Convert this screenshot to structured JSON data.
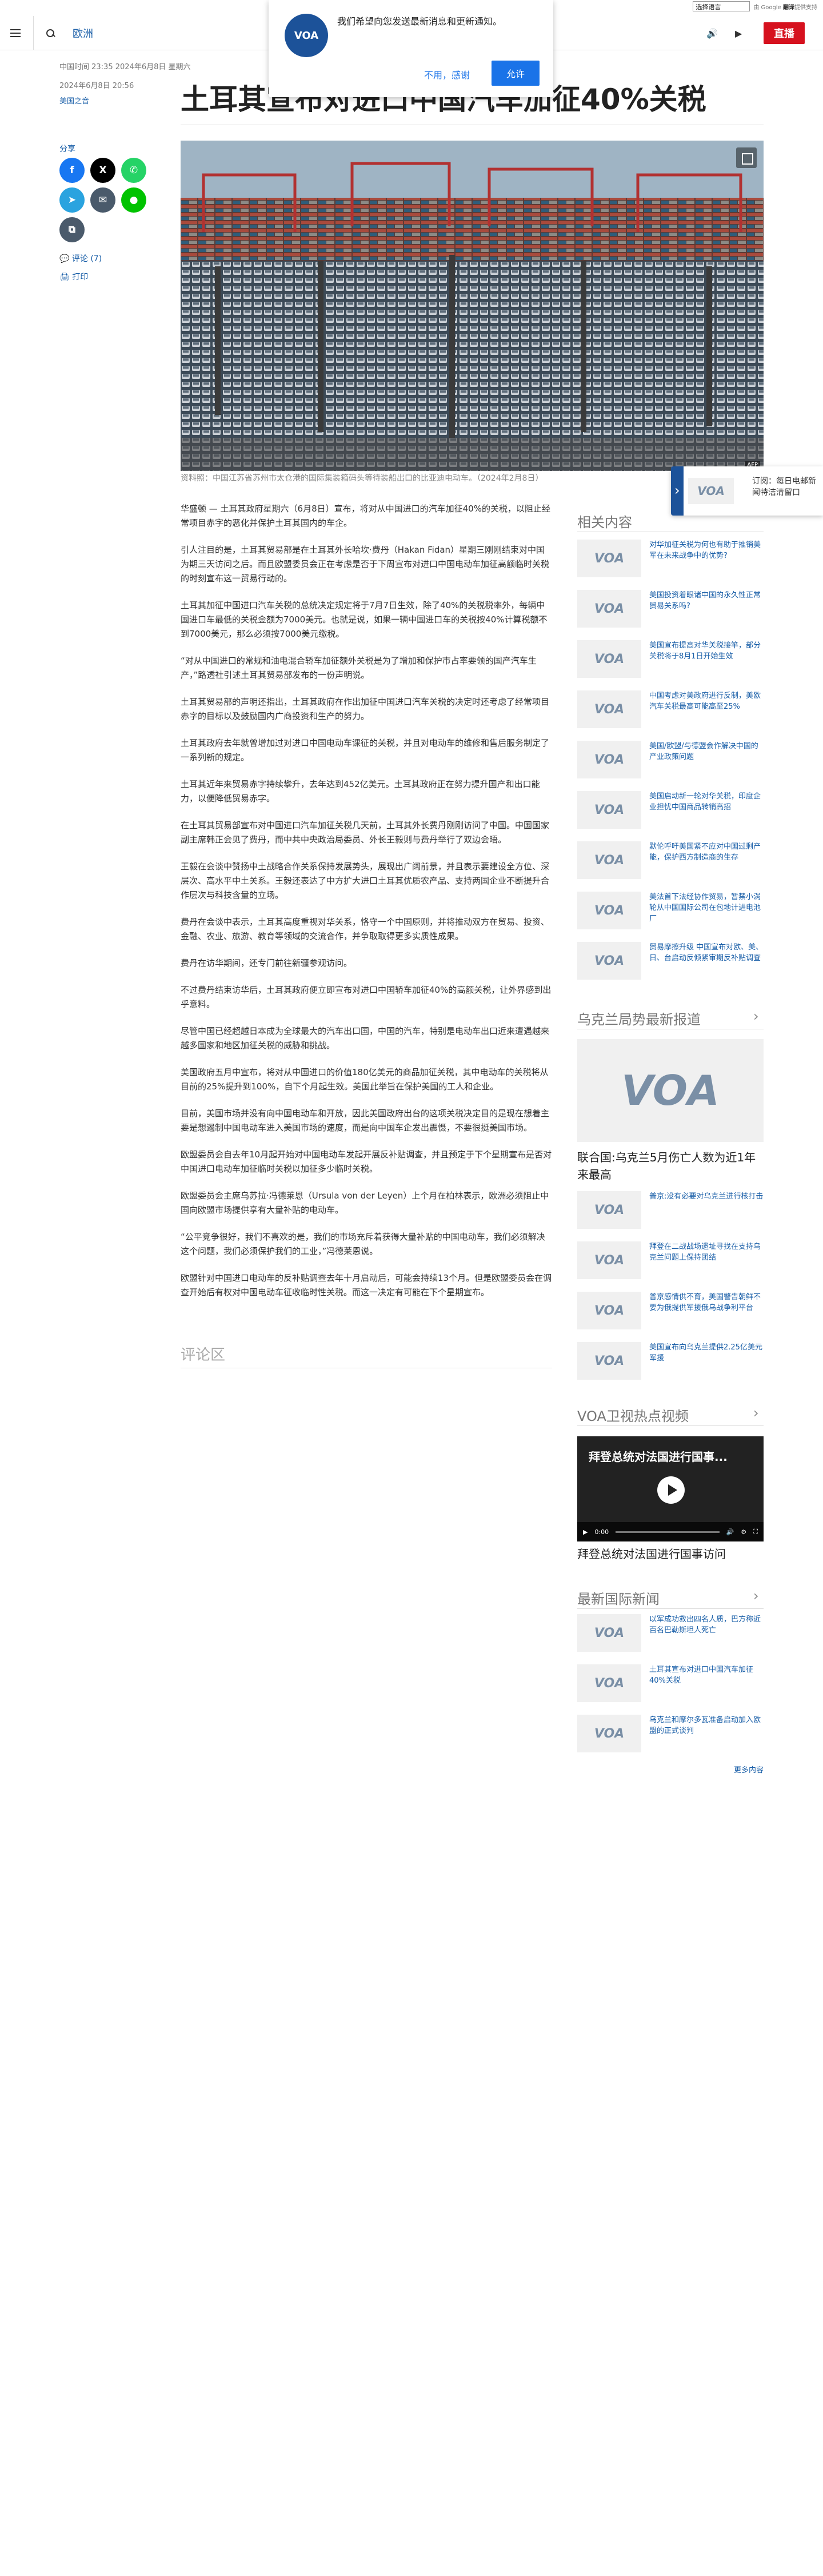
{
  "translate": {
    "select_label": "选择语言",
    "powered_by": "由 Google",
    "brand": "翻译",
    "powered_suffix": "提供支持"
  },
  "header": {
    "section": "欧洲",
    "live": "直播"
  },
  "notification": {
    "logo_text": "VOA",
    "message": "我们希望向您发送最新消息和更新通知。",
    "deny": "不用，感谢",
    "allow": "允许"
  },
  "article_meta": {
    "timezone": "中国时间 23:35 2024年6月8日 星期六",
    "date": "2024年6月8日 20:56",
    "author": "美国之音"
  },
  "share": {
    "label": "分享",
    "comments": "评论 (7)",
    "print": "打印"
  },
  "article": {
    "title": "土耳其宣布对进口中国汽车加征40%关税",
    "caption": "资料照：中国江苏省苏州市太仓港的国际集装箱码头等待装船出口的比亚迪电动车。（2024年2月8日）",
    "credit": "AFP",
    "paragraphs": [
      "华盛顿 — 土耳其政府星期六（6月8日）宣布，将对从中国进口的汽车加征40%的关税，以阻止经常项目赤字的恶化并保护土耳其国内的车企。",
      "引人注目的是，土耳其贸易部是在土耳其外长哈坎·费丹（Hakan Fidan）星期三刚刚结束对中国为期三天访问之后。而且欧盟委员会正在考虑是否于下周宣布对进口中国电动车加征高额临时关税的时刻宣布这一贸易行动的。",
      "土耳其加征中国进口汽车关税的总统决定规定将于7月7日生效，除了40%的关税税率外，每辆中国进口车最低的关税金额为7000美元。也就是说，如果一辆中国进口车的关税按40%计算税额不到7000美元，那么必须按7000美元缴税。",
      "“对从中国进口的常规和油电混合轿车加征额外关税是为了增加和保护市占率要领的国产汽车生产，”路透社引述土耳其贸易部发布的一份声明说。",
      "土耳其贸易部的声明还指出，土耳其政府在作出加征中国进口汽车关税的决定时还考虑了经常项目赤字的目标以及鼓励国内广商投资和生产的努力。",
      "土耳其政府去年就曾增加过对进口中国电动车课征的关税，并且对电动车的维修和售后服务制定了一系列新的规定。",
      "土耳其近年来贸易赤字持续攀升，去年达到452亿美元。土耳其政府正在努力提升国产和出口能力，以便降低贸易赤字。",
      "在土耳其贸易部宣布对中国进口汽车加征关税几天前，土耳其外长费丹刚刚访问了中国。中国国家副主席韩正会见了费丹，而中共中央政治局委员、外长王毅则与费丹举行了双边会晤。",
      "王毅在会谈中赞扬中土战略合作关系保持发展势头，展现出广阔前景，并且表示要建设全方位、深层次、高水平中土关系。王毅还表达了中方扩大进口土耳其优质农产品、支持两国企业不断提升合作层次与科技含量的立场。",
      "费丹在会谈中表示，土耳其高度重视对华关系，恪守一个中国原则，并将推动双方在贸易、投资、金融、农业、旅游、教育等领域的交流合作，并争取取得更多实质性成果。",
      "费丹在访华期间，还专门前往新疆参观访问。",
      "不过费丹结束访华后，土耳其政府便立即宣布对进口中国轿车加征40%的高额关税，让外界感到出乎意料。",
      "尽管中国已经超越日本成为全球最大的汽车出口国，中国的汽车，特别是电动车出口近来遭遇越来越多国家和地区加征关税的威胁和挑战。",
      "美国政府五月中宣布，将对从中国进口的价值180亿美元的商品加征关税，其中电动车的关税将从目前的25%提升到100%，自下个月起生效。美国此举旨在保护美国的工人和企业。",
      "目前，美国市场并没有向中国电动车和开放，因此美国政府出台的这项关税决定目的是现在想着主要是想遏制中国电动车进入美国市场的速度，而是向中国车企发出震慑，不要很挺美国市场。",
      "欧盟委员会自去年10月起开始对中国电动车发起开展反补贴调查，并且预定于下个星期宣布是否对中国进口电动车加征临时关税以加征多少临时关税。",
      "欧盟委员会主席乌苏拉·冯德莱恩（Ursula von der Leyen）上个月在柏林表示，欧洲必须阻止中国向欧盟市场提供享有大量补贴的电动车。",
      "“公平竞争很好，我们不喜欢的是，我们的市场充斥着获得大量补贴的中国电动车，我们必须解决这个问题，我们必须保护我们的工业，”冯德莱恩说。",
      "欧盟针对中国进口电动车的反补贴调查去年十月启动后，可能会持续13个月。但是欧盟委员会在调查开始后有权对中国电动车征收临时性关税。而这一决定有可能在下个星期宣布。"
    ],
    "comments_heading": "评论区"
  },
  "subscribe": {
    "logo_text": "VOA",
    "text": "订阅：每日电邮新闻特洁清留口"
  },
  "related": {
    "heading": "相关内容",
    "items": [
      "对华加征关税为何也有助于推销美军在未来战争中的优势?",
      "美国投资着眼诸中国的永久性正常贸易关系吗?",
      "美国宣布提高对华关税接竿，部分关税将于8月1日开始生效",
      "中国考虑对美政府进行反制，美欧汽车关税最高可能高至25%",
      "美国/欧盟/与德盟会作解决中国的产业政策问题",
      "美国启动新一轮对华关税，印度企业担忧中国商品转销高招",
      "默伦呼吁美国紧不应对中国过剩产能，保护西方制造商的生存",
      "美法首下法经协作贸易，暂禁小涡轮从中国国际公司在包地计进电池厂",
      "贸易摩擦升级 中国宣布对欧、美、日、台启动反倾紧审期反补贴调查"
    ]
  },
  "ukraine": {
    "heading": "乌克兰局势最新报道",
    "big_logo": "VOA",
    "big_caption": "联合国:乌克兰5月伤亡人数为近1年来最高",
    "items": [
      "普京:没有必要对乌克兰进行核打击",
      "拜登在二战战场遗址寻找在支持乌克兰问题上保持团结",
      "普京感情供不育，美国警告朝鲜不要为俄提供军援俄乌战争利平台",
      "美国宣布向乌克兰提供2.25亿美元军援"
    ]
  },
  "video": {
    "heading": "VOA卫视热点视频",
    "overlay_title": "拜登总统对法国进行国事...",
    "time": "0:00",
    "caption": "拜登总统对法国进行国事访问"
  },
  "world": {
    "heading": "最新国际新闻",
    "items": [
      "以军成功救出四名人质，巴方称近百名巴勒斯坦人死亡",
      "土耳其宣布对进口中国汽车加征40%关税",
      "乌克兰和摩尔多瓦准备启动加入欧盟的正式谈判"
    ],
    "more": "更多内容"
  }
}
